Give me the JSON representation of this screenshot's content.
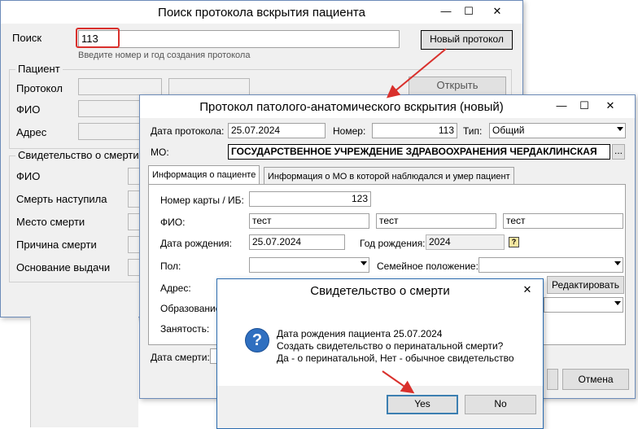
{
  "search_window": {
    "title": "Поиск протокола вскрытия пациента",
    "search_label": "Поиск",
    "search_value": "113",
    "search_hint": "Введите номер и год создания протокола",
    "new_protocol_button": "Новый протокол",
    "patient_group": "Пациент",
    "protocol_label": "Протокол",
    "fio_label": "ФИО",
    "address_label": "Адрес",
    "open_button": "Открыть",
    "certificate_group": "Свидетельство о смерти",
    "cert_labels": [
      "ФИО",
      "Смерть наступила",
      "Место смерти",
      "Причина смерти",
      "Основание выдачи"
    ]
  },
  "protocol_window": {
    "title": "Протокол патолого-анатомического вскрытия (новый)",
    "date_label": "Дата протокола:",
    "date_value": "25.07.2024",
    "number_label": "Номер:",
    "number_value": "113",
    "type_label": "Тип:",
    "type_value": "Общий",
    "mo_label": "МО:",
    "mo_value": "ГОСУДАРСТВЕННОЕ УЧРЕЖДЕНИЕ ЗДРАВООХРАНЕНИЯ ЧЕРДАКЛИНСКАЯ",
    "mo_browse": "...",
    "tabs": [
      "Информация о пациенте",
      "Информация о МО в которой наблюдался и умер пациент"
    ],
    "card_label": "Номер карты / ИБ:",
    "card_value": "123",
    "fio_label": "ФИО:",
    "fio_values": [
      "тест",
      "тест",
      "тест"
    ],
    "birth_label": "Дата рождения:",
    "birth_value": "25.07.2024",
    "birth_year_label": "Год рождения:",
    "birth_year_value": "2024",
    "sex_label": "Пол:",
    "marital_label": "Семейное положение:",
    "address_label": "Адрес:",
    "edit_button": "Редактировать",
    "education_label": "Образование:",
    "employment_label": "Занятость:",
    "death_date_label": "Дата смерти:",
    "cancel_button": "Отмена"
  },
  "dialog": {
    "title": "Свидетельство о смерти",
    "line1": "Дата рождения пациента 25.07.2024",
    "line2": "Создать свидетельство о перинатальной смерти?",
    "line3": "Да - о перинатальной, Нет - обычное свидетельство",
    "yes_button": "Yes",
    "no_button": "No"
  },
  "window_controls": {
    "minimize": "—",
    "maximize": "☐",
    "close": "✕"
  },
  "colors": {
    "highlight": "#d9302c",
    "accent": "#2b6cb0",
    "window_border": "#6c8bb8"
  }
}
